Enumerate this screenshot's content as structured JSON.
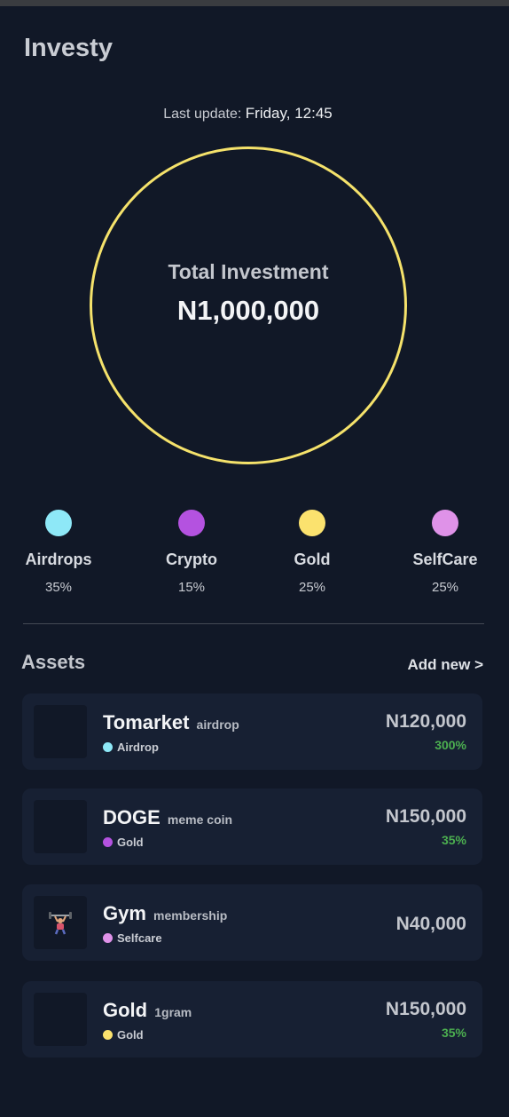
{
  "app": {
    "title": "Investy"
  },
  "last_update": {
    "label": "Last update:",
    "value": "Friday, 12:45"
  },
  "summary": {
    "label": "Total Investment",
    "value": "N1,000,000",
    "ring_color": "#f5e26b"
  },
  "allocation": [
    {
      "name": "Airdrops",
      "percent": "35%",
      "color": "#8ee8f7"
    },
    {
      "name": "Crypto",
      "percent": "15%",
      "color": "#b452e0"
    },
    {
      "name": "Gold",
      "percent": "25%",
      "color": "#fbe26e"
    },
    {
      "name": "SelfCare",
      "percent": "25%",
      "color": "#df92e8"
    }
  ],
  "assets_section": {
    "title": "Assets",
    "add_new_label": "Add new >"
  },
  "assets": [
    {
      "name": "Tomarket",
      "subtitle": "airdrop",
      "category": "Airdrop",
      "category_color": "#8ee8f7",
      "amount": "N120,000",
      "change": "300%",
      "icon": ""
    },
    {
      "name": "DOGE",
      "subtitle": "meme coin",
      "category": "Gold",
      "category_color": "#b452e0",
      "amount": "N150,000",
      "change": "35%",
      "icon": ""
    },
    {
      "name": "Gym",
      "subtitle": "membership",
      "category": "Selfcare",
      "category_color": "#df92e8",
      "amount": "N40,000",
      "change": "",
      "icon": "weightlifter-icon"
    },
    {
      "name": "Gold",
      "subtitle": "1gram",
      "category": "Gold",
      "category_color": "#fbe26e",
      "amount": "N150,000",
      "change": "35%",
      "icon": ""
    }
  ],
  "colors": {
    "background": "#111827",
    "card": "#172033",
    "positive": "#4caf50"
  }
}
